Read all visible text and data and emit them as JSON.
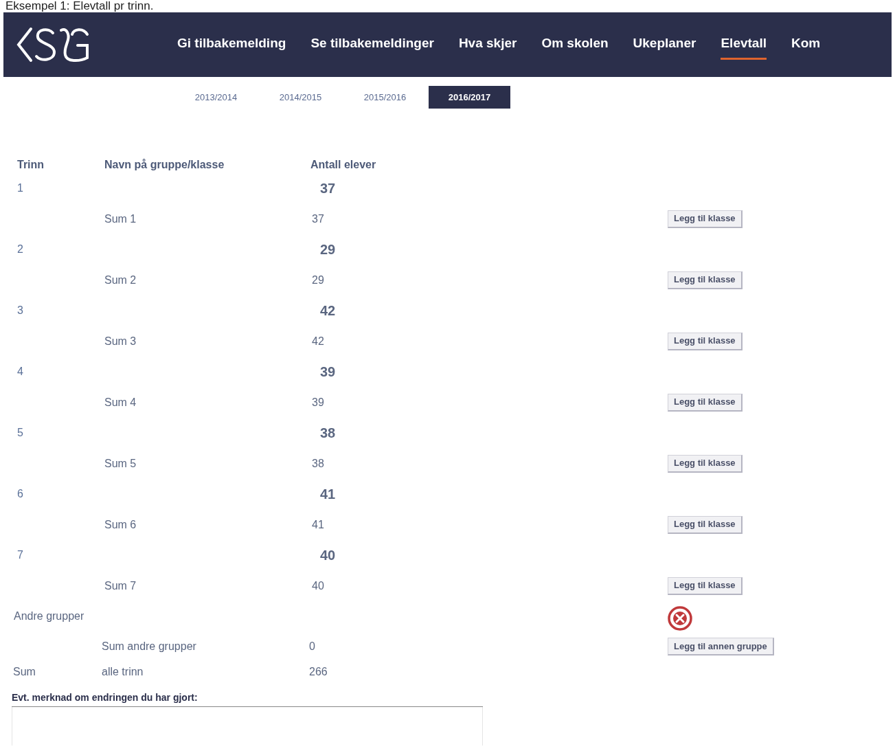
{
  "caption": "Eksempel 1: Elevtall pr trinn.",
  "nav": {
    "items": [
      {
        "label": "Gi tilbakemelding",
        "selected": false
      },
      {
        "label": "Se tilbakemeldinger",
        "selected": false
      },
      {
        "label": "Hva skjer",
        "selected": false
      },
      {
        "label": "Om skolen",
        "selected": false
      },
      {
        "label": "Ukeplaner",
        "selected": false
      },
      {
        "label": "Elevtall",
        "selected": true
      },
      {
        "label": "Kom",
        "selected": false
      }
    ]
  },
  "year_tabs": [
    {
      "label": "2013/2014",
      "selected": false
    },
    {
      "label": "2014/2015",
      "selected": false
    },
    {
      "label": "2015/2016",
      "selected": false
    },
    {
      "label": "2016/2017",
      "selected": true
    }
  ],
  "table": {
    "columns": [
      "Trinn",
      "Navn på gruppe/klasse",
      "Antall elever"
    ],
    "grades": [
      {
        "trinn": "1",
        "count": "37",
        "sum_label": "Sum 1",
        "sum": "37",
        "button": "Legg til klasse"
      },
      {
        "trinn": "2",
        "count": "29",
        "sum_label": "Sum 2",
        "sum": "29",
        "button": "Legg til klasse"
      },
      {
        "trinn": "3",
        "count": "42",
        "sum_label": "Sum 3",
        "sum": "42",
        "button": "Legg til klasse"
      },
      {
        "trinn": "4",
        "count": "39",
        "sum_label": "Sum 4",
        "sum": "39",
        "button": "Legg til klasse"
      },
      {
        "trinn": "5",
        "count": "38",
        "sum_label": "Sum 5",
        "sum": "38",
        "button": "Legg til klasse"
      },
      {
        "trinn": "6",
        "count": "41",
        "sum_label": "Sum 6",
        "sum": "41",
        "button": "Legg til klasse"
      },
      {
        "trinn": "7",
        "count": "40",
        "sum_label": "Sum 7",
        "sum": "40",
        "button": "Legg til klasse"
      }
    ],
    "other": {
      "label": "Andre grupper",
      "sum_label": "Sum andre grupper",
      "sum": "0",
      "button": "Legg til annen gruppe"
    },
    "total": {
      "label": "Sum",
      "name": "alle trinn",
      "sum": "266"
    }
  },
  "comment": {
    "label": "Evt. merknad om endringen du har gjort:"
  }
}
